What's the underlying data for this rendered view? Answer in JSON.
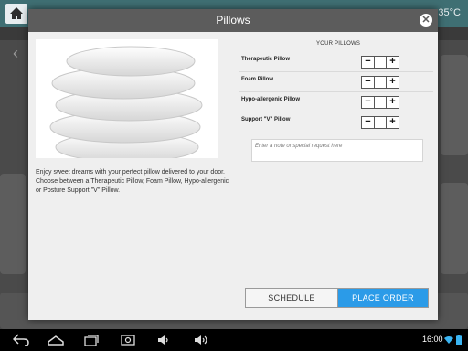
{
  "background": {
    "temperature": "35°C",
    "home_icon": "home-icon",
    "back_arrow": "‹"
  },
  "modal": {
    "title": "Pillows",
    "close_glyph": "✕",
    "image_alt": "Stack of white pillows",
    "description": "Enjoy sweet dreams with your perfect pillow delivered to your door. Choose between a Therapeutic Pillow, Foam Pillow, Hypo-allergenic or Posture Support \"V\" Pillow.",
    "list_heading": "YOUR PILLOWS",
    "pillows": [
      {
        "name": "Therapeutic Pillow",
        "quantity": ""
      },
      {
        "name": "Foam Pillow",
        "quantity": ""
      },
      {
        "name": "Hypo-allergenic Pillow",
        "quantity": ""
      },
      {
        "name": "Support \"V\" Pillow",
        "quantity": ""
      }
    ],
    "stepper": {
      "minus": "−",
      "plus": "+"
    },
    "note_placeholder": "Enter a note or special request here",
    "schedule_label": "SCHEDULE",
    "order_label": "PLACE ORDER"
  },
  "statusbar": {
    "time": "16:00"
  },
  "colors": {
    "accent": "#2b9be8",
    "header": "#5c5c5c",
    "topbar": "#3f6f73"
  }
}
